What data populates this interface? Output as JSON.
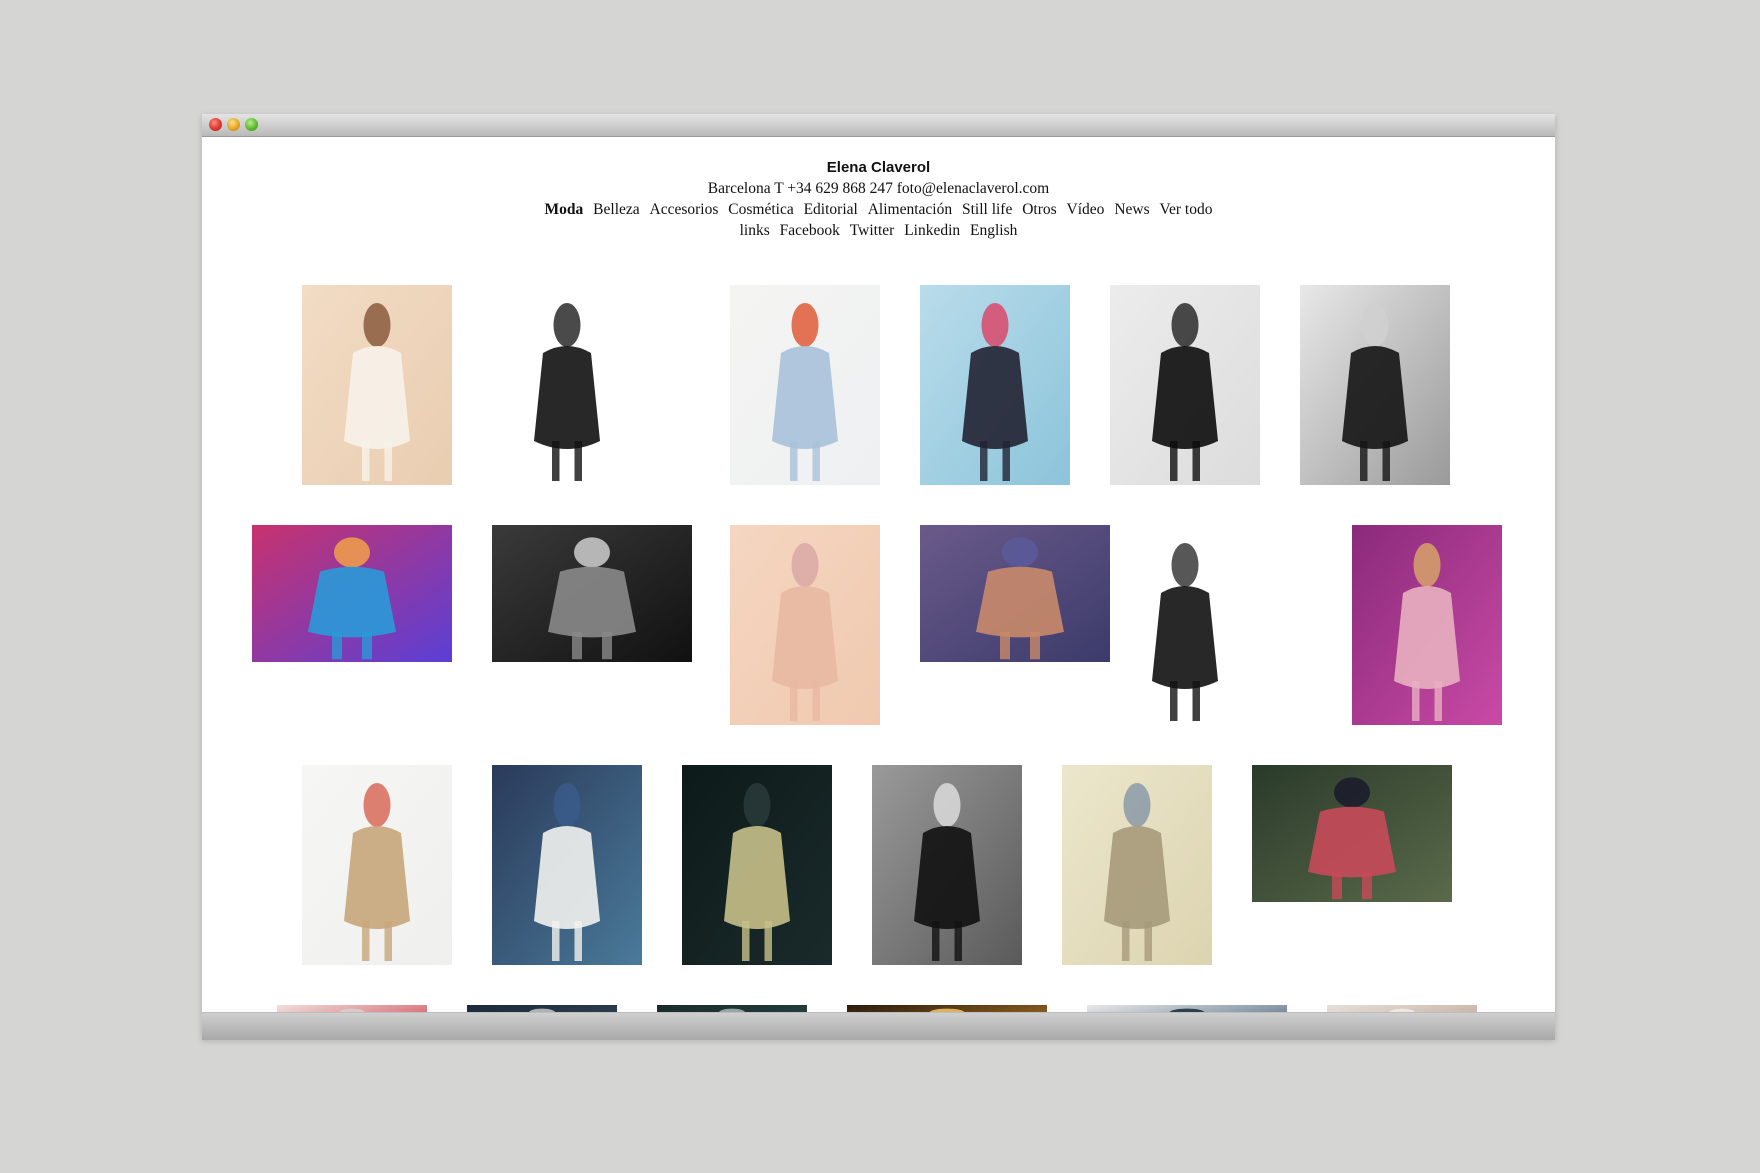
{
  "window": {
    "controls": [
      "close-button",
      "minimize-button",
      "zoom-button"
    ]
  },
  "site": {
    "title": "Elena Claverol",
    "contact": "Barcelona T +34 629 868 247 foto@elenaclaverol.com"
  },
  "nav": {
    "row1": [
      "Moda",
      "Belleza",
      "Accesorios",
      "Cosmética",
      "Editorial",
      "Alimentación",
      "Still life",
      "Otros",
      "Vídeo",
      "News",
      "Ver todo"
    ],
    "row2": [
      "links",
      "Facebook",
      "Twitter",
      "Linkedin",
      "English"
    ],
    "active": "Moda"
  },
  "gallery": {
    "photos": [
      {
        "name": "photo-model-white-jacket-handbag",
        "colors": [
          "#f2dcc4",
          "#e9cdb1",
          "#f7f2ea",
          "#8a5a3c"
        ]
      },
      {
        "name": "photo-bw-model-wild-hair",
        "colors": [
          "#ffffff",
          "#ffffff",
          "#111111",
          "#2a2a2a"
        ]
      },
      {
        "name": "photo-model-jeans-green-line",
        "colors": [
          "#f4f4f2",
          "#eef0f2",
          "#a9c1d9",
          "#e05a3a"
        ]
      },
      {
        "name": "photo-model-polka-dot-makeup",
        "colors": [
          "#b9dceb",
          "#8cc4da",
          "#222233",
          "#d9486a"
        ]
      },
      {
        "name": "photo-model-black-dress-grey",
        "colors": [
          "#ececec",
          "#dcdcdc",
          "#0c0c0c",
          "#2a2a2a"
        ]
      },
      {
        "name": "photo-bw-lace-mask",
        "colors": [
          "#e8e8e8",
          "#9a9a9a",
          "#141414",
          "#d0d0d0"
        ]
      },
      {
        "name": "photo-colorful-portrait",
        "colors": [
          "#c8326e",
          "#5a3fd6",
          "#2a9ad8",
          "#f2a04a"
        ]
      },
      {
        "name": "photo-bw-cafe",
        "colors": [
          "#3a3a3a",
          "#111111",
          "#8a8a8a",
          "#cfcfcf"
        ]
      },
      {
        "name": "photo-blonde-lace-peach",
        "colors": [
          "#f5d6c0",
          "#f0c9b0",
          "#e8b8a2",
          "#d9a8a6"
        ]
      },
      {
        "name": "photo-model-sofa-purple",
        "colors": [
          "#6a5a8a",
          "#3a3a6a",
          "#c98a6a",
          "#5a5a9a"
        ]
      },
      {
        "name": "photo-illustration-black-dress",
        "colors": [
          "#ffffff",
          "#ffffff",
          "#111111",
          "#3a3a3a"
        ]
      },
      {
        "name": "photo-pink-pattern-gown",
        "colors": [
          "#8a2a7a",
          "#c94aa6",
          "#e8b0c0",
          "#d7a26a"
        ]
      },
      {
        "name": "photo-model-necklace-floral",
        "colors": [
          "#f6f6f4",
          "#efefed",
          "#c8a67a",
          "#d76a5a"
        ]
      },
      {
        "name": "photo-model-hat-white-dress",
        "colors": [
          "#2a3a5a",
          "#4a7a9a",
          "#f2f2ee",
          "#3a5a8a"
        ]
      },
      {
        "name": "photo-dark-curly-hair",
        "colors": [
          "#0d1a1a",
          "#1a2a2a",
          "#c8c08a",
          "#2a3a3a"
        ]
      },
      {
        "name": "photo-bw-black-dress-door",
        "colors": [
          "#9a9a9a",
          "#5a5a5a",
          "#111111",
          "#dcdcdc"
        ]
      },
      {
        "name": "photo-cage-dress-room",
        "colors": [
          "#ece6cc",
          "#dcd4b0",
          "#a69a7a",
          "#8a9aa8"
        ]
      },
      {
        "name": "photo-model-garden-flowers",
        "colors": [
          "#2a3a2a",
          "#5a6a4a",
          "#c84a5a",
          "#1a1a2a"
        ]
      },
      {
        "name": "photo-red-hair-partial",
        "colors": [
          "#f0e0dc",
          "#c92a3a",
          "#2a1a1a",
          "#d8d0cc"
        ]
      },
      {
        "name": "photo-dark-partial-1",
        "colors": [
          "#1a2a3a",
          "#3a4a5a",
          "#0d1318",
          "#c8c8c8"
        ]
      },
      {
        "name": "photo-dark-partial-2",
        "colors": [
          "#1a2a2a",
          "#2a4a4a",
          "#0d1a1a",
          "#a8b8b8"
        ]
      },
      {
        "name": "photo-sparkle-partial",
        "colors": [
          "#2a1a0d",
          "#c88a2a",
          "#1a0d06",
          "#f2c86a"
        ]
      },
      {
        "name": "photo-blue-partial",
        "colors": [
          "#e8e8e8",
          "#2a4a6a",
          "#c8d8e8",
          "#1a2a3a"
        ]
      },
      {
        "name": "photo-portrait-partial",
        "colors": [
          "#e6e0da",
          "#b89a8a",
          "#5a3a2a",
          "#f0ece8"
        ]
      }
    ]
  }
}
